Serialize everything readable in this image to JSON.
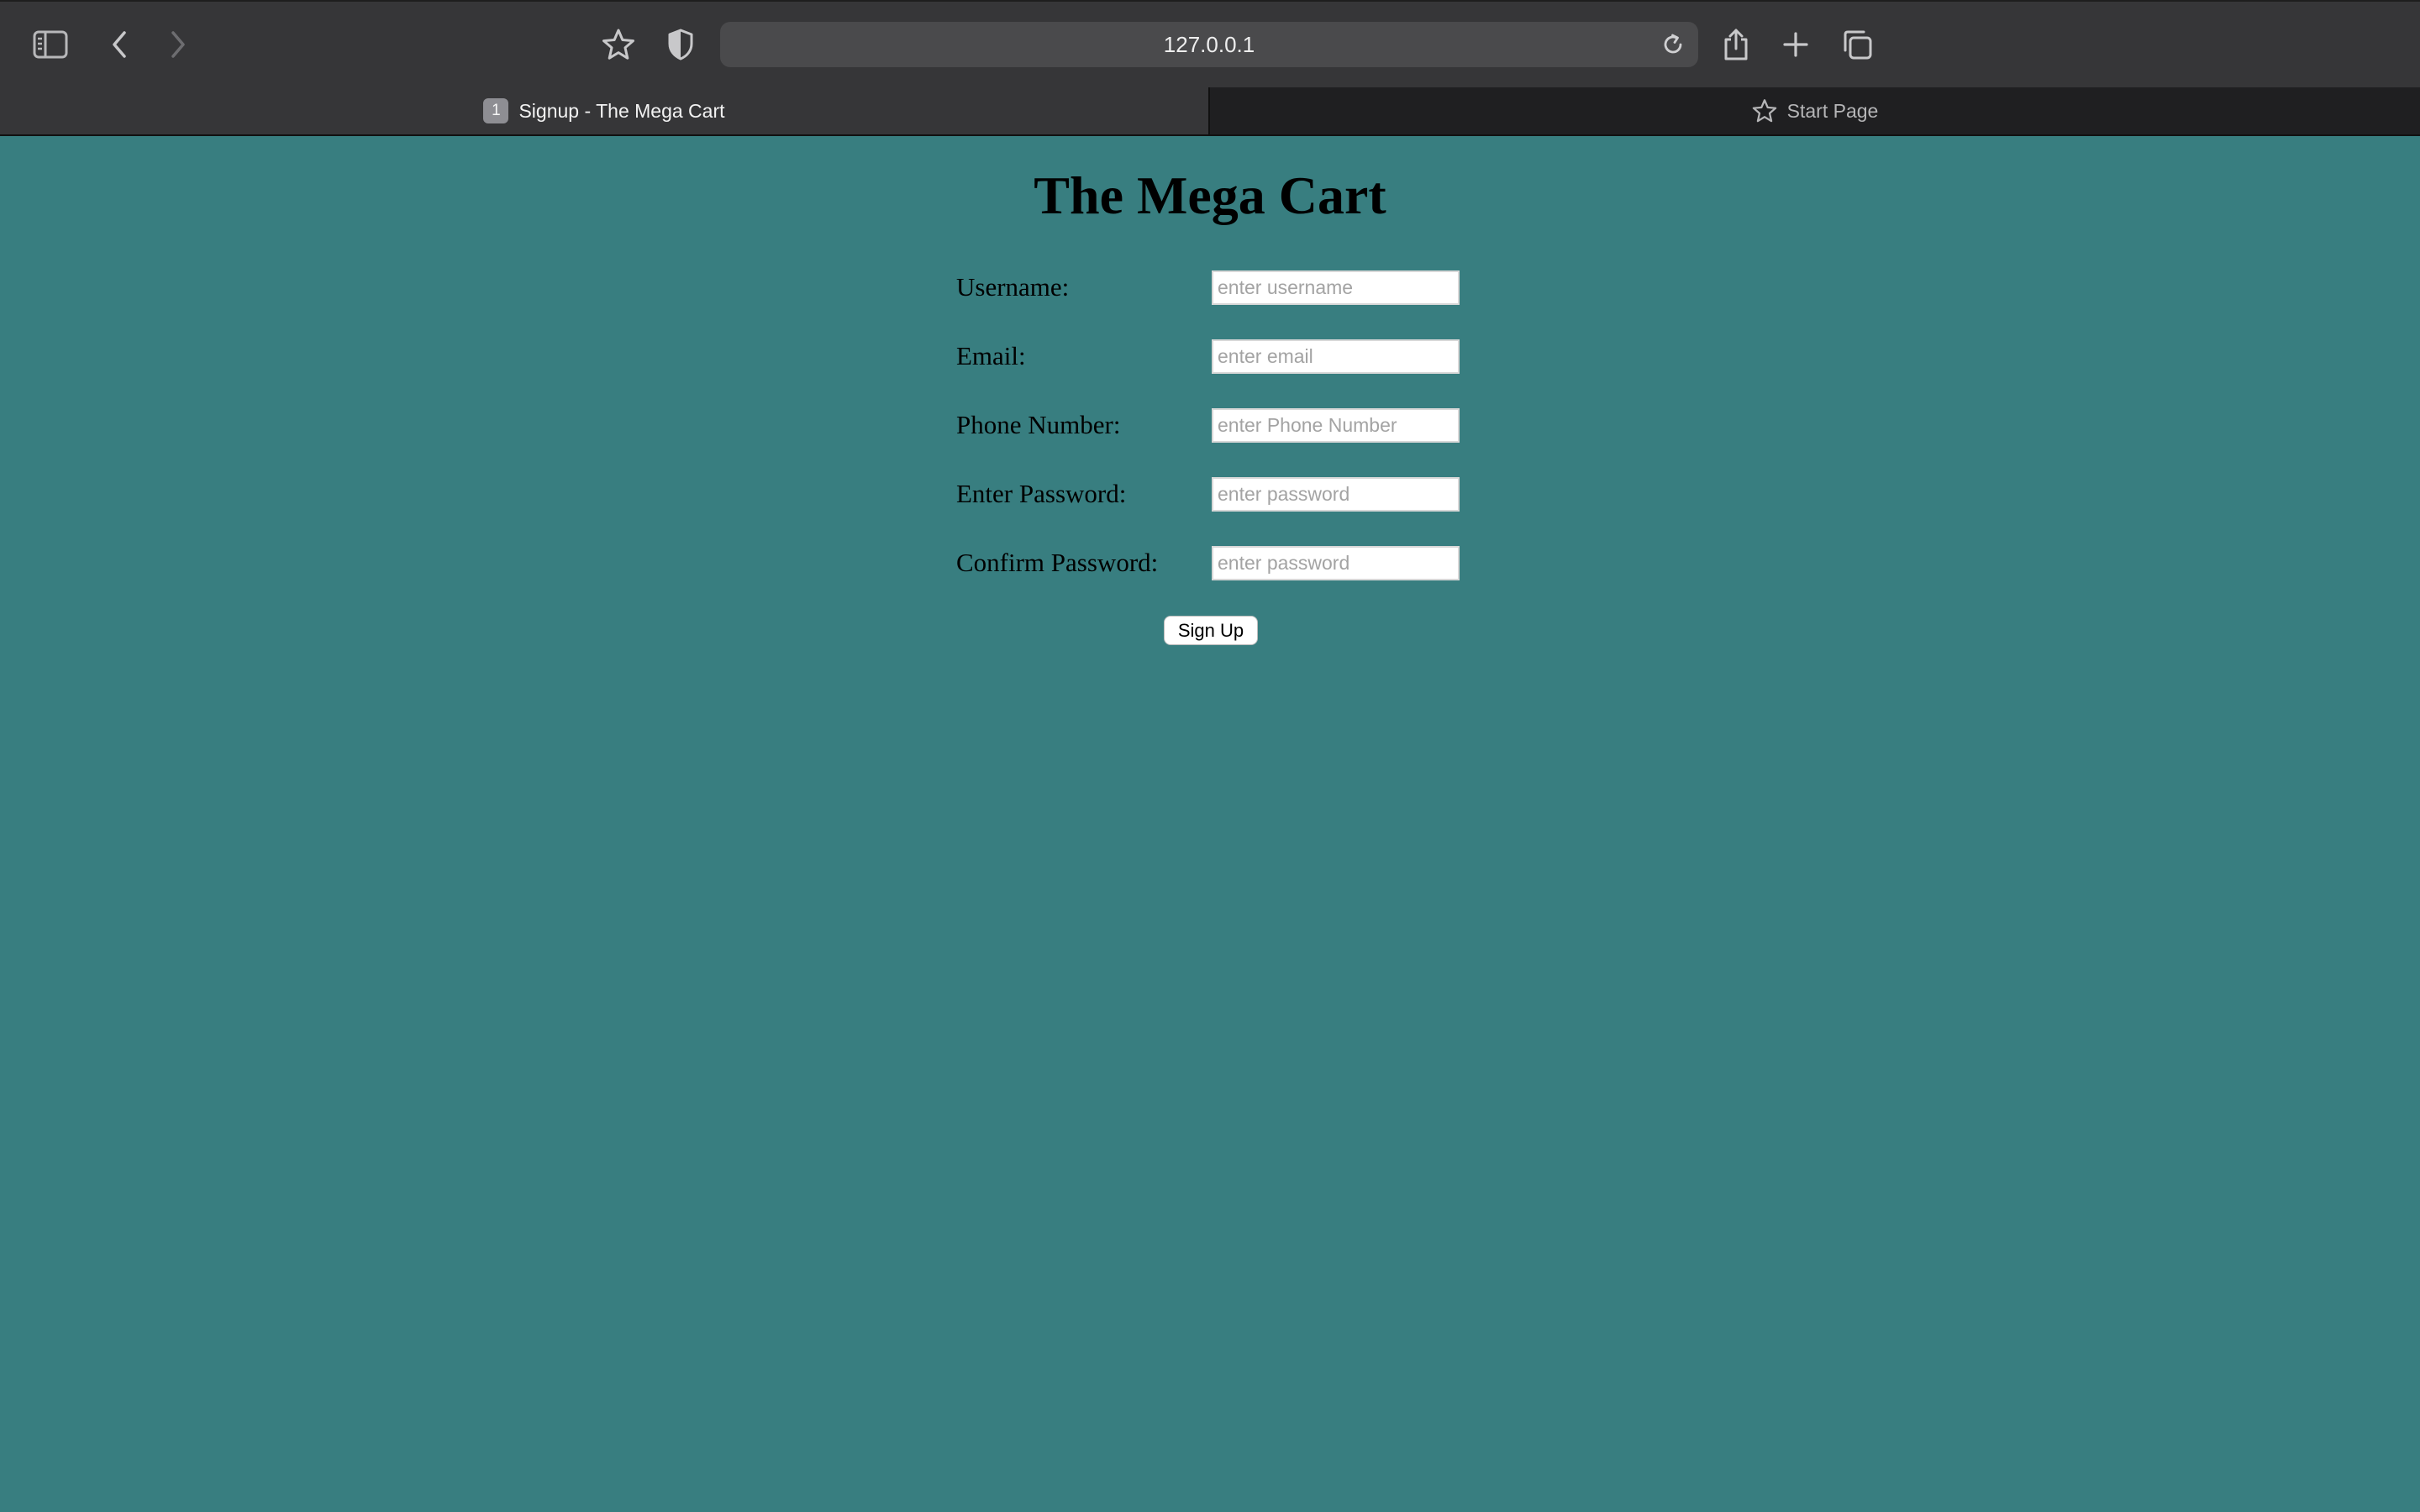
{
  "browser": {
    "url": "127.0.0.1",
    "tabs": [
      {
        "number": "1",
        "label": "Signup - The Mega Cart",
        "active": true
      },
      {
        "label": "Start Page",
        "icon": "star-icon",
        "active": false
      }
    ],
    "toolbar_icons": [
      "sidebar-icon",
      "back-icon",
      "forward-icon",
      "star-icon",
      "shield-icon",
      "reload-icon",
      "share-icon",
      "plus-icon",
      "tabs-overview-icon"
    ]
  },
  "page": {
    "background": "#387e80",
    "title": "The Mega Cart",
    "fields": [
      {
        "label": "Username:",
        "placeholder": "enter username",
        "value": ""
      },
      {
        "label": "Email:",
        "placeholder": "enter email",
        "value": ""
      },
      {
        "label": "Phone Number:",
        "placeholder": "enter Phone Number",
        "value": ""
      },
      {
        "label": "Enter Password:",
        "placeholder": "enter password",
        "value": ""
      },
      {
        "label": "Confirm Password:",
        "placeholder": "enter password",
        "value": ""
      }
    ],
    "submit_label": "Sign Up"
  }
}
